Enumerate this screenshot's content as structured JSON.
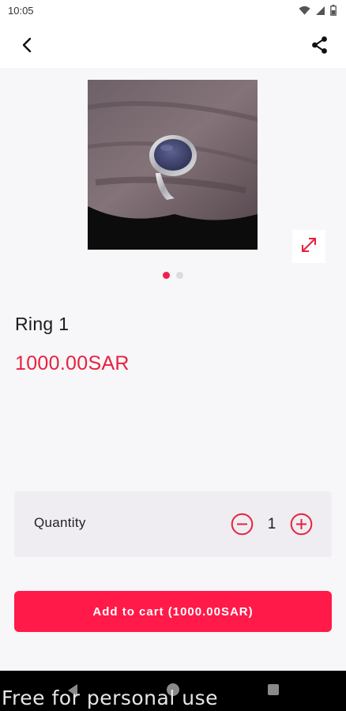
{
  "status_bar": {
    "time": "10:05",
    "icons": [
      "wifi-icon",
      "signal-icon",
      "battery-icon"
    ]
  },
  "app_bar": {
    "back_icon": "back-arrow-icon",
    "share_icon": "share-icon"
  },
  "gallery": {
    "image_subject": "ring",
    "image_count": 2,
    "active_index": 0,
    "expand_icon": "expand-icon"
  },
  "product": {
    "name": "Ring 1",
    "price": "1000.00SAR"
  },
  "quantity": {
    "label": "Quantity",
    "value": "1",
    "decrement_icon": "minus-circle-icon",
    "increment_icon": "plus-circle-icon"
  },
  "cart": {
    "button_label": "Add to cart (1000.00SAR)"
  },
  "watermark": {
    "text": "Free for personal use"
  },
  "colors": {
    "accent": "#ff1a4a",
    "price": "#e8213f",
    "background": "#f7f6f8",
    "card": "#efedf2"
  }
}
